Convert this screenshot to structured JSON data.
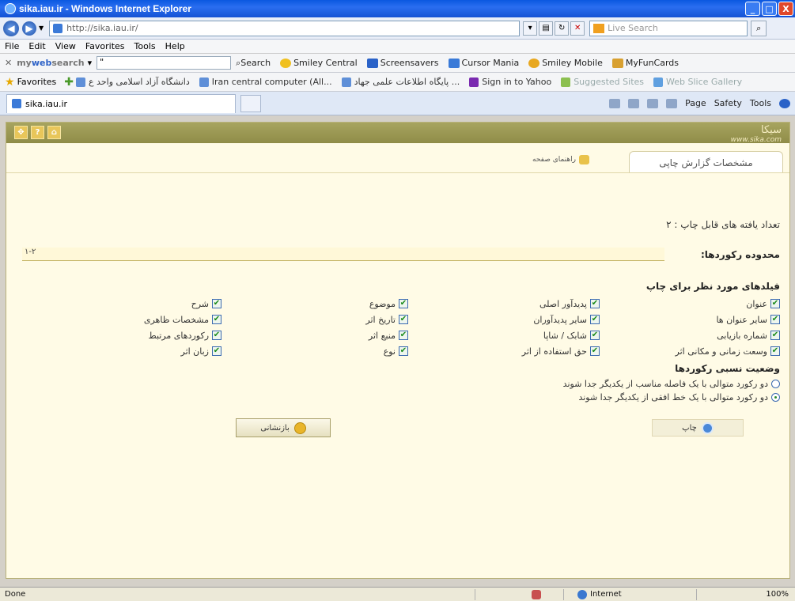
{
  "window": {
    "title": "sika.iau.ir - Windows Internet Explorer",
    "min": "_",
    "max": "□",
    "close": "X"
  },
  "address": {
    "url": "http://sika.iau.ir/",
    "search_placeholder": "Live Search"
  },
  "menu": [
    "File",
    "Edit",
    "View",
    "Favorites",
    "Tools",
    "Help"
  ],
  "mywebsearch": {
    "brand_prefix": "my",
    "brand_web": "web",
    "brand_suffix": "search",
    "input_value": "\"",
    "items": [
      {
        "label": "Search",
        "color": "#ffffff"
      },
      {
        "label": "Smiley Central",
        "color": "#f0c020"
      },
      {
        "label": "Screensavers",
        "color": "#2a62c8"
      },
      {
        "label": "Cursor Mania",
        "color": "#3a7ad8"
      },
      {
        "label": "Smiley Mobile",
        "color": "#e8a820"
      },
      {
        "label": "MyFunCards",
        "color": "#d8a030"
      }
    ]
  },
  "favorites": {
    "label": "Favorites",
    "items": [
      "دانشگاه آزاد اسلامی واحد ع",
      "Iran central computer (All...",
      "پایگاه اطلاعات علمی جهاد ...",
      "Sign in to Yahoo",
      "Suggested Sites",
      "Web Slice Gallery"
    ]
  },
  "tab": {
    "label": "sika.iau.ir"
  },
  "commandbar": {
    "page": "Page",
    "safety": "Safety",
    "tools": "Tools"
  },
  "page": {
    "logo_text": "سیکا",
    "logo_url": "www.sika.com",
    "tab_print": "مشخصات گزارش چاپی",
    "tab_help": "راهنمای صفحه",
    "count_line": "تعداد یافته های قابل چاپ : ۲",
    "range_label": "محدوده رکوردها:",
    "range_value": "۱-۲",
    "fields_title": "فیلدهای مورد نظر برای چاپ",
    "fields": {
      "col1": [
        "عنوان",
        "سایر عنوان ها",
        "شماره بازیابی",
        "وسعت زمانی و مکانی اثر"
      ],
      "col2": [
        "پدیدآور اصلی",
        "سایر پدیدآوران",
        "شابک / شاپا",
        "حق استفاده از اثر"
      ],
      "col3": [
        "موضوع",
        "تاریخ اثر",
        "منبع اثر",
        "نوع"
      ],
      "col4": [
        "شرح",
        "مشخصات ظاهری",
        "رکوردهای مرتبط",
        "زبان اثر"
      ]
    },
    "display_title": "وضعیت نسبی رکوردها",
    "radio1": "دو رکورد متوالی با یک فاصله مناسب از یکدیگر جدا شوند",
    "radio2": "دو رکورد متوالی با یک خط افقی از یکدیگر جدا شوند",
    "print_label": "چاپ",
    "reset_label": "بازنشانی"
  },
  "status": {
    "left": "Done",
    "zone": "Internet",
    "zoom": "100%"
  }
}
